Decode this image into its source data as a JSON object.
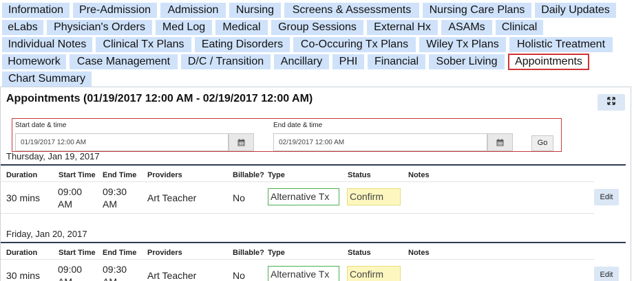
{
  "tabs": {
    "row1": [
      "Information",
      "Pre-Admission",
      "Admission",
      "Nursing",
      "Screens & Assessments",
      "Nursing Care Plans",
      "Daily Updates"
    ],
    "row2": [
      "eLabs",
      "Physician's Orders",
      "Med Log",
      "Medical",
      "Group Sessions",
      "External Hx",
      "ASAMs",
      "Clinical"
    ],
    "row3": [
      "Individual Notes",
      "Clinical Tx Plans",
      "Eating Disorders",
      "Co-Occuring Tx Plans",
      "Wiley Tx Plans",
      "Holistic Treatment"
    ],
    "row4": [
      "Homework",
      "Case Management",
      "D/C / Transition",
      "Ancillary",
      "PHI",
      "Financial",
      "Sober Living",
      "Appointments"
    ],
    "row5": [
      "Chart Summary"
    ],
    "active": "Appointments"
  },
  "panel": {
    "title": "Appointments (01/19/2017 12:00 AM - 02/19/2017 12:00 AM)"
  },
  "filter": {
    "start_label": "Start date & time",
    "start_value": "01/19/2017 12:00 AM",
    "end_label": "End date & time",
    "end_value": "02/19/2017 12:00 AM",
    "go_label": "Go"
  },
  "columns": {
    "duration": "Duration",
    "start_time": "Start Time",
    "end_time": "End Time",
    "providers": "Providers",
    "billable": "Billable?",
    "type": "Type",
    "status": "Status",
    "notes": "Notes"
  },
  "days": [
    {
      "header": "Thursday, Jan 19, 2017",
      "rows": [
        {
          "duration": "30 mins",
          "start_l1": "09:00",
          "start_l2": "AM",
          "end_l1": "09:30",
          "end_l2": "AM",
          "provider": "Art Teacher",
          "billable": "No",
          "type": "Alternative Tx",
          "status": "Confirm",
          "notes": "",
          "edit": "Edit"
        }
      ]
    },
    {
      "header": "Friday, Jan 20, 2017",
      "rows": [
        {
          "duration": "30 mins",
          "start_l1": "09:00",
          "start_l2": "AM",
          "end_l1": "09:30",
          "end_l2": "AM",
          "provider": "Art Teacher",
          "billable": "No",
          "type": "Alternative Tx",
          "status": "Confirm",
          "notes": "",
          "edit": "Edit"
        }
      ]
    }
  ],
  "icons": {
    "expand": "expand-icon",
    "calendar": "calendar-icon"
  },
  "colors": {
    "tab_bg": "#cfe2fa",
    "active_border": "#d23333",
    "type_border": "#4caf50",
    "status_bg": "#fdf7bf",
    "rule": "#2e3a54"
  }
}
